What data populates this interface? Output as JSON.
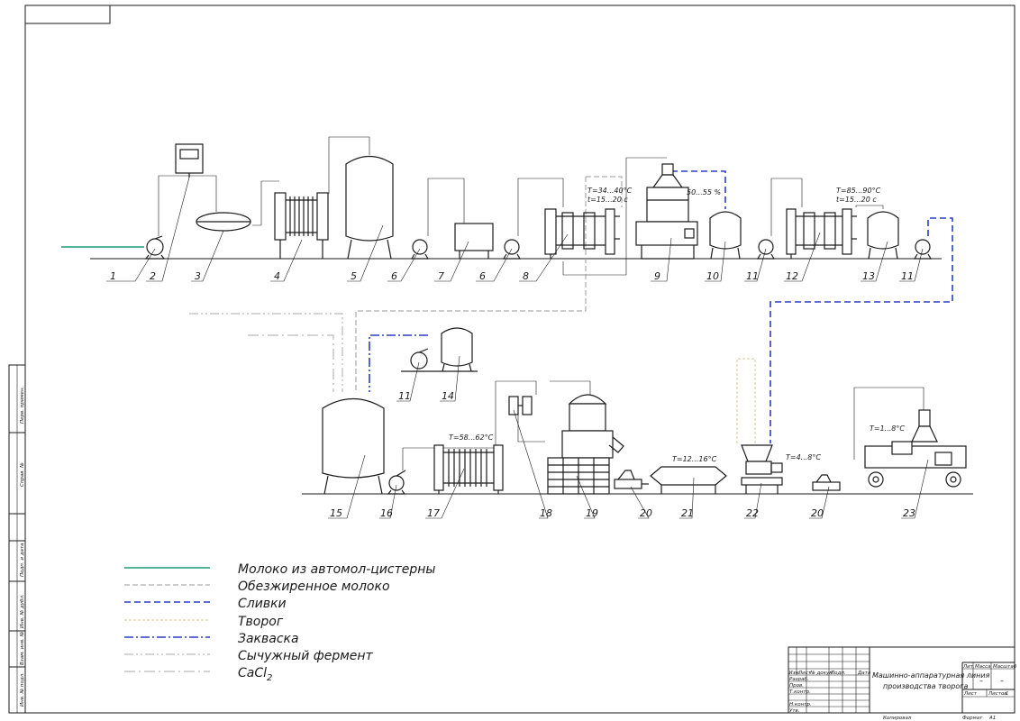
{
  "title_block": {
    "title_line1": "Машинно-аппаратурная линия",
    "title_line2": "производства творога",
    "lit": "Лит.",
    "mass": "Масса",
    "scale": "Масштаб",
    "sheet": "Лист",
    "sheets": "Листов",
    "sheets_count": "1",
    "dash1": "–",
    "dash2": "–",
    "col_izm": "Изм.",
    "col_list": "Лист",
    "col_doc": "№ докум.",
    "col_sign": "Подп.",
    "col_date": "Дата",
    "row_razrab": "Разраб.",
    "row_prov": "Пров.",
    "row_tkontr": "Т.контр.",
    "row_nkontr": "Н.контр.",
    "row_utv": "Утв.",
    "copied": "Копировал",
    "format": "Формат",
    "format_value": "A1"
  },
  "side_stamp": {
    "labels": [
      "Перв. примен.",
      "Справ. №",
      "Подп. и дата",
      "Инв. № дубл.",
      "Взам. инв. №",
      "Подп. и дата",
      "Инв. № подл."
    ]
  },
  "legend": [
    {
      "label": "Молоко из автомол-цистерны",
      "color": "#1a9a7a",
      "dash": "",
      "width": 1.6
    },
    {
      "label": "Обезжиренное молоко",
      "color": "#9a9a9a",
      "dash": "6 3",
      "width": 1
    },
    {
      "label": "Сливки",
      "color": "#2a3fc0",
      "dash": "7 4",
      "width": 1.6
    },
    {
      "label": "Творог",
      "color": "#d8c890",
      "dash": "3 2",
      "width": 1
    },
    {
      "label": "Закваска",
      "color": "#2a3fc0",
      "dash": "10 3 2 3",
      "width": 1.6
    },
    {
      "label": "Сычужный фермент",
      "color": "#aaaaaa",
      "dash": "10 3 2 3 2 3",
      "width": 1
    },
    {
      "label": "CaCl",
      "sub": "2",
      "color": "#aaaaaa",
      "dash": "12 4 2 4",
      "width": 1
    }
  ],
  "numbers_top": [
    "1",
    "2",
    "3",
    "4",
    "5",
    "6",
    "7",
    "6",
    "8",
    "9",
    "10",
    "11",
    "12",
    "13",
    "11"
  ],
  "numbers_bottom": [
    "15",
    "16",
    "17",
    "18",
    "19",
    "20",
    "21",
    "22",
    "20",
    "23"
  ],
  "numbers_mid": [
    "11",
    "14"
  ],
  "annotations": {
    "t8_temp": "T=34...40°C",
    "t8_time": "t=15...20 c",
    "sep_fat": "50...55 %",
    "t12_temp": "T=85...90°C",
    "t12_time": "t=15...20 c",
    "t17": "T=58...62°C",
    "t21": "T=12...16°C",
    "t22": "T=4...8°C",
    "t23": "T=1...8°C"
  }
}
